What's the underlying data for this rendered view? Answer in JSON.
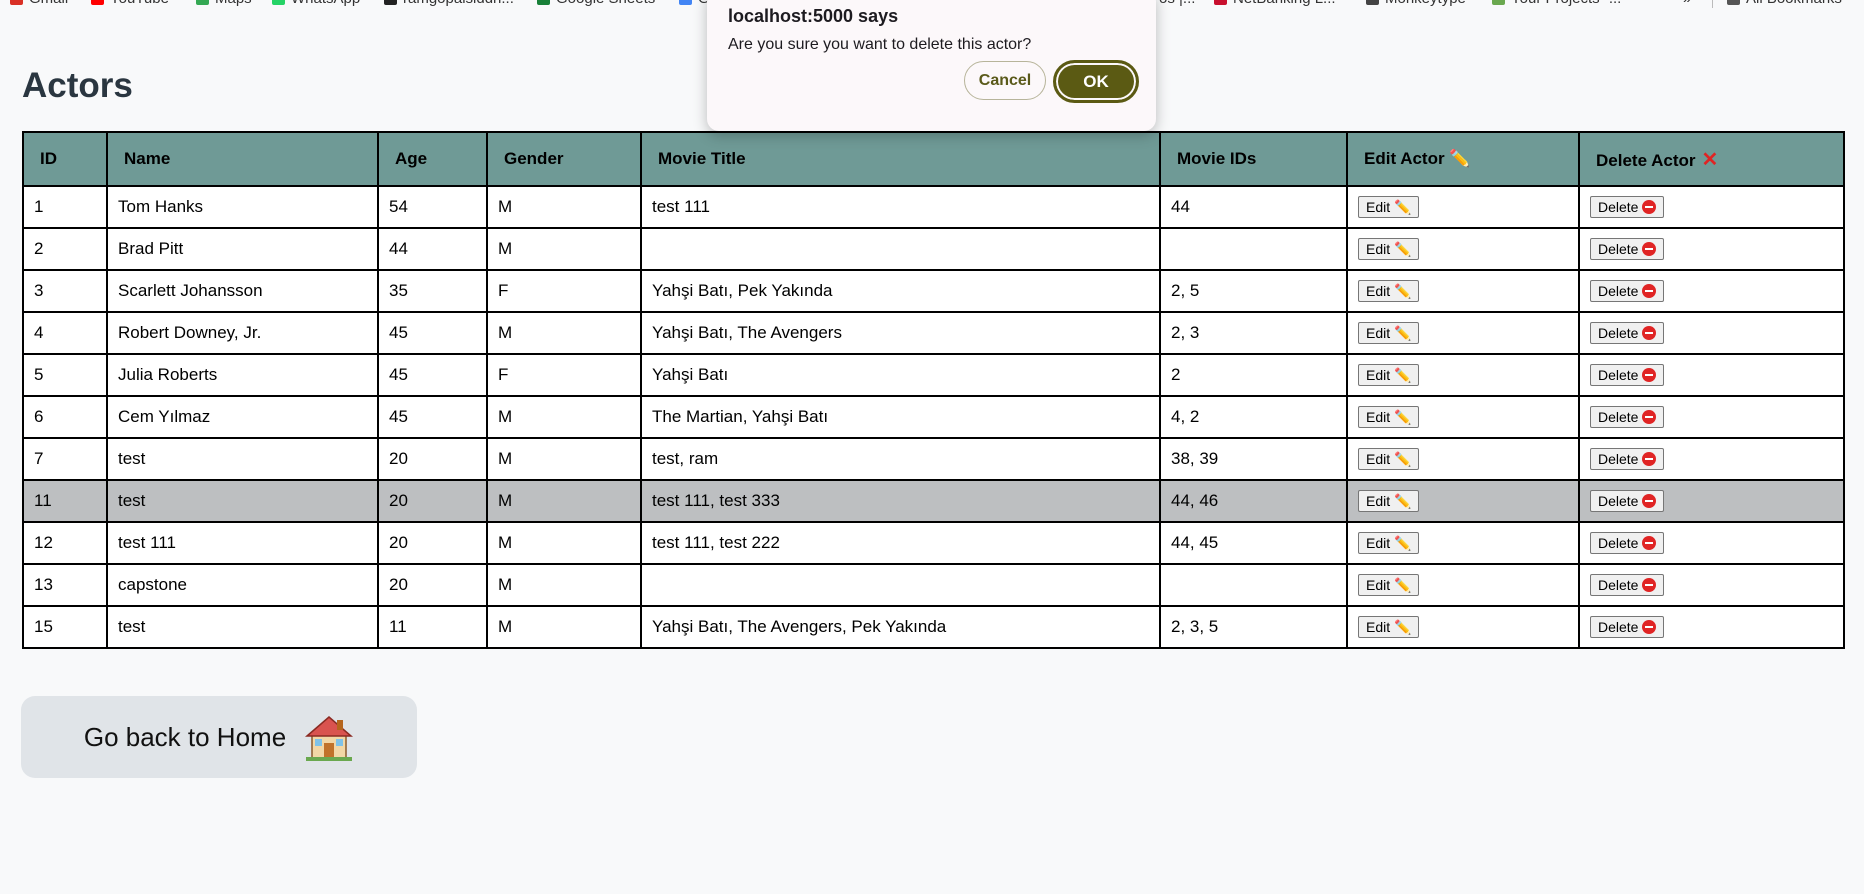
{
  "bookmarks": [
    {
      "label": "Gmail",
      "color": "#d93025"
    },
    {
      "label": "YouTube",
      "color": "#ff0000"
    },
    {
      "label": "Maps",
      "color": "#34a853"
    },
    {
      "label": "WhatsApp",
      "color": "#25d366"
    },
    {
      "label": "ramgopalsiddh...",
      "color": "#222222"
    },
    {
      "label": "Google Sheets",
      "color": "#188038"
    },
    {
      "label": "G",
      "color": "#4285f4"
    },
    {
      "label": "os |...",
      "color": "#888888"
    },
    {
      "label": "NetBanking L...",
      "color": "#c8102e"
    },
    {
      "label": "Monkeytype",
      "color": "#444444"
    },
    {
      "label": "Your Projects -...",
      "color": "#6aa84f"
    },
    {
      "label": "»",
      "color": ""
    },
    {
      "label": "All Bookmarks",
      "color": "#555555"
    }
  ],
  "page": {
    "title": "Actors",
    "home_button": "Go back to Home",
    "home_icon": "🏠"
  },
  "table": {
    "headers": {
      "id": "ID",
      "name": "Name",
      "age": "Age",
      "gender": "Gender",
      "movie_title": "Movie Title",
      "movie_ids": "Movie IDs",
      "edit": "Edit Actor ✏️",
      "delete": "Delete Actor"
    },
    "edit_label": "Edit ✏️",
    "delete_label": "Delete",
    "rows": [
      {
        "id": "1",
        "name": "Tom Hanks",
        "age": "54",
        "gender": "M",
        "movie_title": "test 111",
        "movie_ids": "44"
      },
      {
        "id": "2",
        "name": "Brad Pitt",
        "age": "44",
        "gender": "M",
        "movie_title": "",
        "movie_ids": ""
      },
      {
        "id": "3",
        "name": "Scarlett Johansson",
        "age": "35",
        "gender": "F",
        "movie_title": "Yahşi Batı, Pek Yakında",
        "movie_ids": "2, 5"
      },
      {
        "id": "4",
        "name": "Robert Downey, Jr.",
        "age": "45",
        "gender": "M",
        "movie_title": "Yahşi Batı, The Avengers",
        "movie_ids": "2, 3"
      },
      {
        "id": "5",
        "name": "Julia Roberts",
        "age": "45",
        "gender": "F",
        "movie_title": "Yahşi Batı",
        "movie_ids": "2"
      },
      {
        "id": "6",
        "name": "Cem Yılmaz",
        "age": "45",
        "gender": "M",
        "movie_title": "The Martian, Yahşi Batı",
        "movie_ids": "4, 2"
      },
      {
        "id": "7",
        "name": "test",
        "age": "20",
        "gender": "M",
        "movie_title": "test, ram",
        "movie_ids": "38, 39"
      },
      {
        "id": "11",
        "name": "test",
        "age": "20",
        "gender": "M",
        "movie_title": "test 111, test 333",
        "movie_ids": "44, 46",
        "highlighted": true
      },
      {
        "id": "12",
        "name": "test 111",
        "age": "20",
        "gender": "M",
        "movie_title": "test 111, test 222",
        "movie_ids": "44, 45"
      },
      {
        "id": "13",
        "name": "capstone",
        "age": "20",
        "gender": "M",
        "movie_title": "",
        "movie_ids": ""
      },
      {
        "id": "15",
        "name": "test",
        "age": "11",
        "gender": "M",
        "movie_title": "Yahşi Batı, The Avengers, Pek Yakında",
        "movie_ids": "2, 3, 5"
      }
    ]
  },
  "dialog": {
    "title": "localhost:5000 says",
    "message": "Are you sure you want to delete this actor?",
    "cancel_label": "Cancel",
    "ok_label": "OK"
  }
}
